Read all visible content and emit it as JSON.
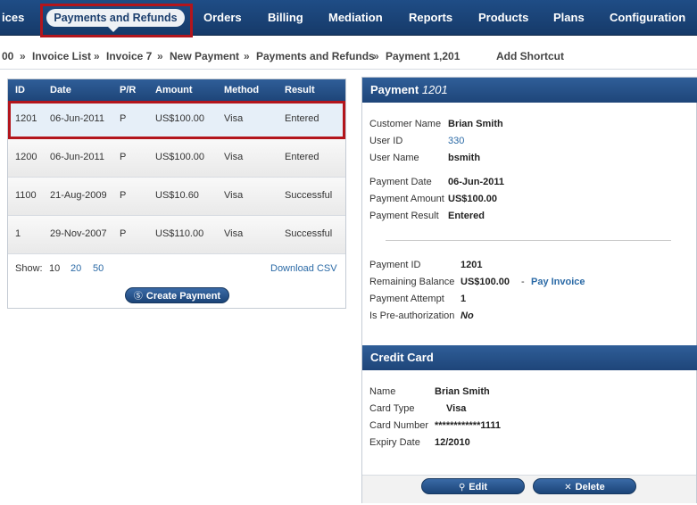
{
  "nav": {
    "items": [
      "ices",
      "Orders",
      "Billing",
      "Mediation",
      "Reports",
      "Products",
      "Plans",
      "Configuration"
    ],
    "active": "Payments and Refunds"
  },
  "breadcrumb": {
    "items": [
      "00",
      "Invoice List",
      "Invoice 7",
      "New Payment",
      "Payments and Refunds",
      "Payment 1,201"
    ],
    "separator": "»",
    "shortcut": "Add Shortcut"
  },
  "payments_table": {
    "columns": [
      "ID",
      "Date",
      "P/R",
      "Amount",
      "Method",
      "Result"
    ],
    "rows": [
      [
        "1201",
        "06-Jun-2011",
        "P",
        "US$100.00",
        "Visa",
        "Entered"
      ],
      [
        "1200",
        "06-Jun-2011",
        "P",
        "US$100.00",
        "Visa",
        "Entered"
      ],
      [
        "1100",
        "21-Aug-2009",
        "P",
        "US$10.60",
        "Visa",
        "Successful"
      ],
      [
        "1",
        "29-Nov-2007",
        "P",
        "US$110.00",
        "Visa",
        "Successful"
      ]
    ],
    "show_label": "Show:",
    "page_sizes": [
      "10",
      "20",
      "50"
    ],
    "download": "Download CSV",
    "create_button": "Create Payment"
  },
  "payment_panel": {
    "title": "Payment",
    "title_id": "1201",
    "customer": [
      {
        "label": "Customer Name",
        "value": "Brian Smith"
      },
      {
        "label": "User ID",
        "value": "330"
      },
      {
        "label": "User Name",
        "value": "bsmith"
      }
    ],
    "payment": [
      {
        "label": "Payment Date",
        "value": "06-Jun-2011"
      },
      {
        "label": "Payment Amount",
        "value": "US$100.00"
      },
      {
        "label": "Payment Result",
        "value": "Entered"
      }
    ],
    "details": [
      {
        "label": "Payment ID",
        "value": "1201"
      },
      {
        "label": "Remaining Balance",
        "value": "US$100.00"
      },
      {
        "label": "Payment Attempt",
        "value": "1"
      },
      {
        "label": "Is Pre-authorization",
        "value": "No"
      }
    ],
    "balance_separator": "-",
    "pay_invoice": "Pay Invoice"
  },
  "credit_card": {
    "title": "Credit Card",
    "fields": [
      {
        "label": "Name",
        "value": "Brian Smith"
      },
      {
        "label": "Card Type",
        "value": "Visa"
      },
      {
        "label": "Card Number",
        "value": "************1111"
      },
      {
        "label": "Expiry Date",
        "value": "12/2010"
      }
    ],
    "edit_button": "Edit",
    "delete_button": "Delete"
  },
  "colors": {
    "nav_bg": "#1f4d86",
    "header_bg": "#2f5e98",
    "link": "#2b6aa6",
    "highlight": "#b3151c"
  }
}
